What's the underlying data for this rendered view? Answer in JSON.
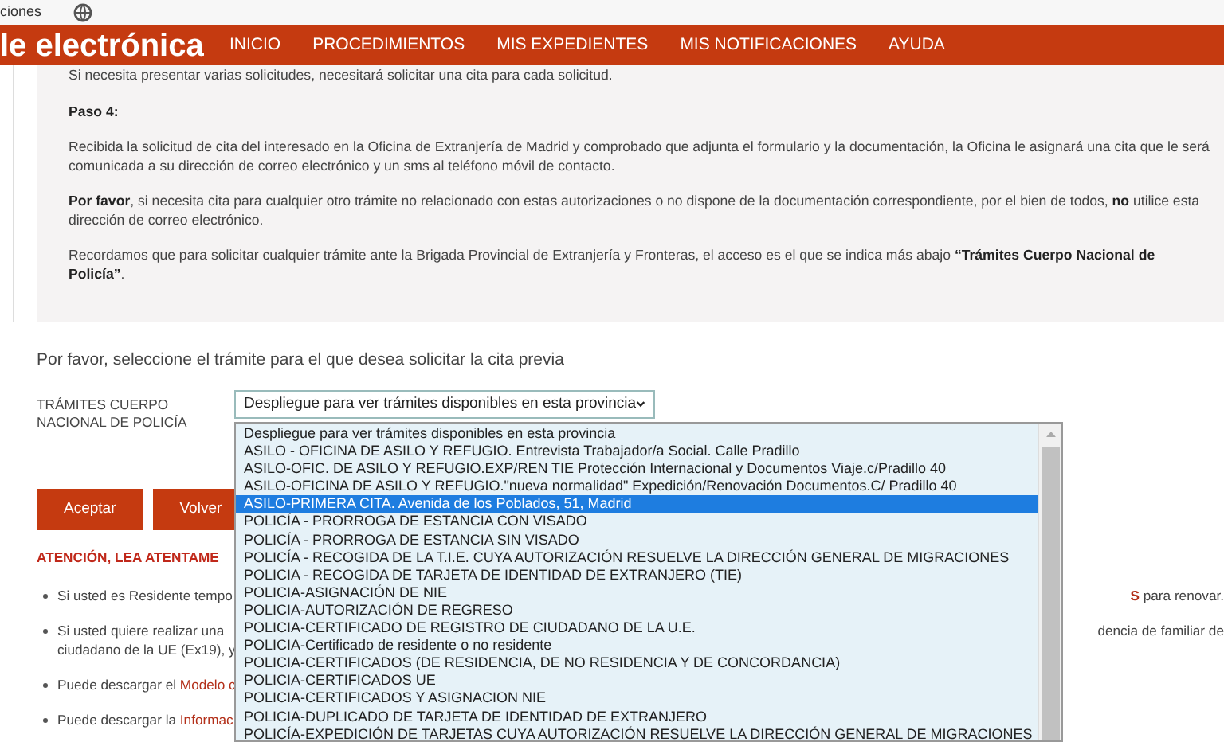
{
  "browser_bar": {
    "text": "ciones"
  },
  "header": {
    "brand": "le electrónica",
    "nav": [
      {
        "label": "INICIO"
      },
      {
        "label": "PROCEDIMIENTOS"
      },
      {
        "label": "MIS EXPEDIENTES"
      },
      {
        "label": "MIS NOTIFICACIONES"
      },
      {
        "label": "AYUDA"
      }
    ]
  },
  "info_panel": {
    "paragraphs": [
      "Si necesita presentar varias solicitudes, necesitará solicitar una cita para cada solicitud.",
      "**Paso 4:**",
      "Recibida la solicitud de cita del interesado en la Oficina de Extranjería de Madrid y comprobado que adjunta el formulario y la documentación, la Oficina le asignará una cita que le será comunicada a su dirección de correo electrónico y un sms al teléfono móvil de contacto.",
      "**Por favor**, si necesita cita para cualquier otro trámite no relacionado con estas autorizaciones o no dispone de la documentación correspondiente, por el bien de todos, **no** utilice esta dirección de correo electrónico.",
      "Recordamos que para solicitar cualquier trámite ante la Brigada Provincial de Extranjería y Fronteras, el acceso es el que se indica más abajo **“Trámites Cuerpo Nacional de Policía”**."
    ]
  },
  "prompt": "Por favor, seleccione el trámite para el que desea solicitar la cita previa",
  "form": {
    "label": "TRÁMITES CUERPO NACIONAL DE POLICÍA",
    "select_value": "Despliegue para ver trámites disponibles en esta provincia",
    "options": [
      {
        "label": "Despliegue para ver trámites disponibles en esta provincia",
        "selected": false
      },
      {
        "label": "ASILO - OFICINA DE ASILO Y REFUGIO. Entrevista Trabajador/a Social. Calle Pradillo",
        "selected": false
      },
      {
        "label": "ASILO-OFIC. DE ASILO Y REFUGIO.EXP/REN TIE Protección Internacional y Documentos Viaje.c/Pradillo 40",
        "selected": false
      },
      {
        "label": "ASILO-OFICINA DE ASILO Y REFUGIO.\"nueva normalidad\" Expedición/Renovación Documentos.C/ Pradillo 40",
        "selected": false
      },
      {
        "label": "ASILO-PRIMERA CITA. Avenida de los Poblados, 51, Madrid",
        "selected": true
      },
      {
        "label": "POLICÍA - PRORROGA DE ESTANCIA CON VISADO",
        "selected": false
      },
      {
        "label": "POLICÍA - PRORROGA DE ESTANCIA SIN VISADO",
        "selected": false
      },
      {
        "label": "POLICÍA - RECOGIDA DE LA T.I.E. CUYA AUTORIZACIÓN RESUELVE LA DIRECCIÓN GENERAL DE MIGRACIONES",
        "selected": false
      },
      {
        "label": "POLICIA - RECOGIDA DE TARJETA DE IDENTIDAD DE EXTRANJERO (TIE)",
        "selected": false
      },
      {
        "label": "POLICIA-ASIGNACIÓN DE NIE",
        "selected": false
      },
      {
        "label": "POLICIA-AUTORIZACIÓN DE REGRESO",
        "selected": false
      },
      {
        "label": "POLICIA-CERTIFICADO DE REGISTRO DE CIUDADANO DE LA U.E.",
        "selected": false
      },
      {
        "label": "POLICIA-Certificado de residente o no residente",
        "selected": false
      },
      {
        "label": "POLICIA-CERTIFICADOS (DE RESIDENCIA, DE NO RESIDENCIA Y DE CONCORDANCIA)",
        "selected": false
      },
      {
        "label": "POLICIA-CERTIFICADOS UE",
        "selected": false
      },
      {
        "label": "POLICIA-CERTIFICADOS Y ASIGNACION NIE",
        "selected": false
      },
      {
        "label": "POLICIA-DUPLICADO DE TARJETA DE IDENTIDAD DE EXTRANJERO",
        "selected": false
      },
      {
        "label": "POLICÍA-EXPEDICIÓN DE TARJETAS CUYA AUTORIZACIÓN RESUELVE LA DIRECCIÓN GENERAL DE MIGRACIONES",
        "selected": false
      }
    ]
  },
  "buttons": [
    {
      "label": "Aceptar"
    },
    {
      "label": "Volver"
    }
  ],
  "notice": {
    "title": "ATENCIÓN, LEA ATENTAME",
    "bullets": [
      {
        "left": [
          "Si usted es Residente tempo"
        ],
        "right": "**S** para renovar."
      },
      {
        "left": [
          "Si usted quiere realizar una",
          "ciudadano de la UE (Ex19), y"
        ],
        "right": "dencia de familiar de"
      },
      {
        "left": [
          "Puede descargar el **Modelo c**"
        ]
      },
      {
        "left": [
          "Puede descargar la **Informac**"
        ]
      }
    ]
  }
}
